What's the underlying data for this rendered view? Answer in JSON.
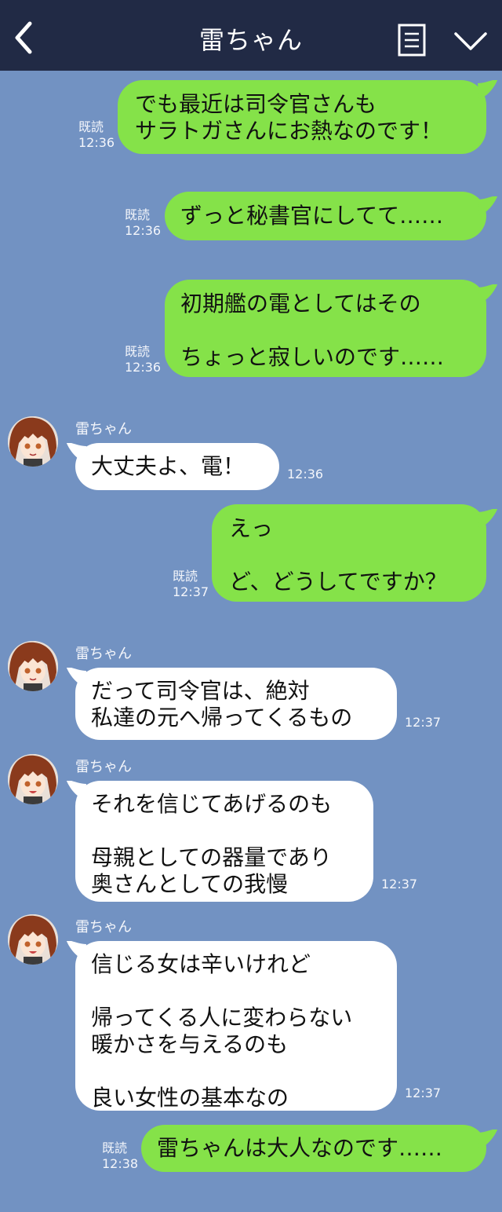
{
  "header": {
    "title": "雷ちゃん"
  },
  "contact": {
    "name": "雷ちゃん"
  },
  "colors": {
    "header_bg": "#212a45",
    "chat_bg": "#7292c2",
    "outgoing": "#85e249",
    "incoming": "#ffffff"
  },
  "messages": [
    {
      "dir": "out",
      "text": "でも最近は司令官さんも\nサラトガさんにお熱なのです！",
      "read": "既読",
      "time": "12:36"
    },
    {
      "dir": "out",
      "text": "ずっと秘書官にしてて……",
      "read": "既読",
      "time": "12:36"
    },
    {
      "dir": "out",
      "text": "初期艦の電としてはその\n\nちょっと寂しいのです……",
      "read": "既読",
      "time": "12:36"
    },
    {
      "dir": "in",
      "text": "大丈夫よ、電！",
      "time": "12:36"
    },
    {
      "dir": "out",
      "text": "えっ\n\nど、どうしてですか？",
      "read": "既読",
      "time": "12:37"
    },
    {
      "dir": "in",
      "text": "だって司令官は、絶対\n私達の元へ帰ってくるもの",
      "time": "12:37"
    },
    {
      "dir": "in",
      "text": "それを信じてあげるのも\n\n母親としての器量であり\n奥さんとしての我慢",
      "time": "12:37"
    },
    {
      "dir": "in",
      "text": "信じる女は辛いけれど\n\n帰ってくる人に変わらない\n暖かさを与えるのも\n\n良い女性の基本なの",
      "time": "12:37"
    },
    {
      "dir": "out",
      "text": "雷ちゃんは大人なのです……",
      "read": "既読",
      "time": "12:38"
    }
  ]
}
